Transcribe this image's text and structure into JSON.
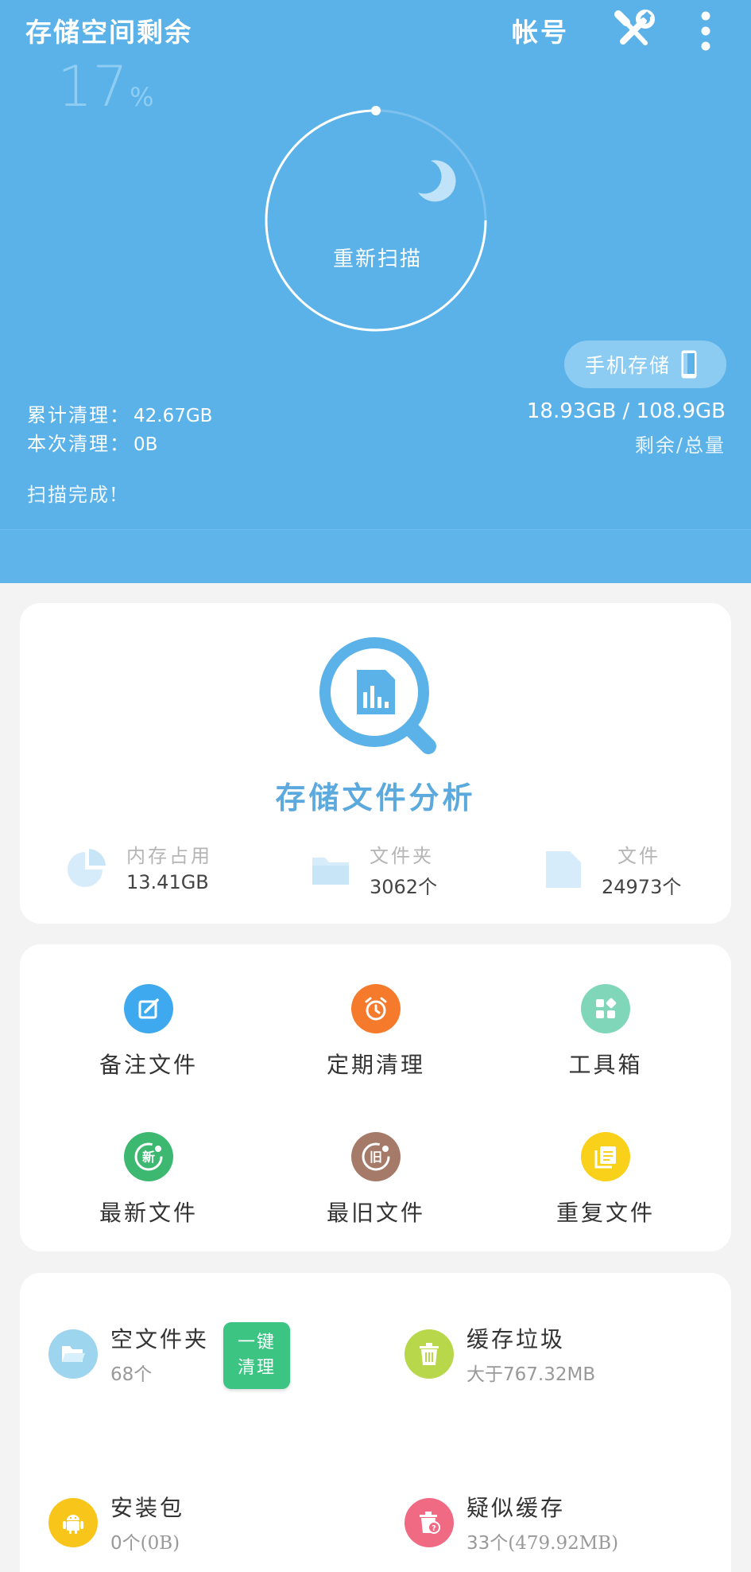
{
  "header": {
    "title": "存储空间剩余",
    "account_label": "帐号",
    "percent_value": "17",
    "percent_sign": "%",
    "rescan_label": "重新扫描",
    "storage_selector_label": "手机存储",
    "cumulative_label": "累计清理：",
    "cumulative_value": "42.67GB",
    "current_label": "本次清理：",
    "current_value": "0B",
    "capacity": "18.93GB / 108.9GB",
    "capacity_label": "剩余/总量",
    "scan_status": "扫描完成!"
  },
  "analysis": {
    "title": "存储文件分析",
    "stats": [
      {
        "label": "内存占用",
        "value": "13.41GB",
        "unit": ""
      },
      {
        "label": "文件夹",
        "value": "3062",
        "unit": "个"
      },
      {
        "label": "文件",
        "value": "24973",
        "unit": "个"
      }
    ]
  },
  "tools": {
    "items": [
      {
        "label": "备注文件",
        "color": "#3ea9ef"
      },
      {
        "label": "定期清理",
        "color": "#f57a2c"
      },
      {
        "label": "工具箱",
        "color": "#7fd6b8"
      },
      {
        "label": "最新文件",
        "color": "#3cb871",
        "badge": "新"
      },
      {
        "label": "最旧文件",
        "color": "#a67a68",
        "badge": "旧"
      },
      {
        "label": "重复文件",
        "color": "#f9d01a"
      }
    ]
  },
  "clean": {
    "one_click_label_1": "一键",
    "one_click_label_2": "清理",
    "items": [
      {
        "name": "空文件夹",
        "count": "68",
        "suffix": "个",
        "color": "#9dd5ef"
      },
      {
        "name": "缓存垃圾",
        "prefix": "大于",
        "count": "767.32MB",
        "color": "#b9d74a"
      },
      {
        "name": "安装包",
        "count": "0",
        "suffix": "个(0B)",
        "color": "#f8c51a"
      },
      {
        "name": "疑似缓存",
        "count": "33",
        "suffix": "个(479.92MB)",
        "color": "#f06a84"
      }
    ]
  },
  "colors": {
    "header_bg": "#5bb2e8",
    "accent": "#5ba9dd",
    "green": "#3cc483"
  }
}
